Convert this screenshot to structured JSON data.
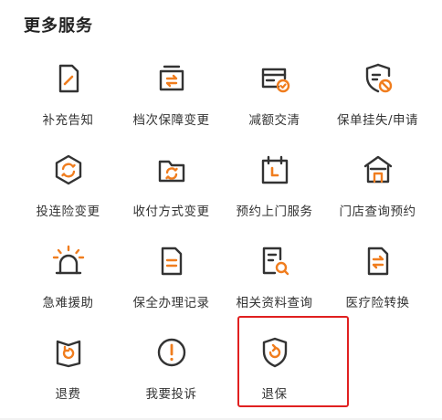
{
  "section": {
    "title": "更多服务"
  },
  "services": [
    {
      "label": "补充告知",
      "icon": "edit-document-icon"
    },
    {
      "label": "档次保障变更",
      "icon": "change-level-icon"
    },
    {
      "label": "减额交清",
      "icon": "card-check-icon"
    },
    {
      "label": "保单挂失/申请",
      "icon": "shield-block-icon"
    },
    {
      "label": "投连险变更",
      "icon": "hexagon-refresh-icon"
    },
    {
      "label": "收付方式变更",
      "icon": "folder-refresh-icon"
    },
    {
      "label": "预约上门服务",
      "icon": "calendar-icon"
    },
    {
      "label": "门店查询预约",
      "icon": "store-icon"
    },
    {
      "label": "急难援助",
      "icon": "alarm-icon"
    },
    {
      "label": "保全办理记录",
      "icon": "record-document-icon"
    },
    {
      "label": "相关资料查询",
      "icon": "document-search-icon"
    },
    {
      "label": "医疗险转换",
      "icon": "document-transfer-icon"
    },
    {
      "label": "退费",
      "icon": "refund-icon"
    },
    {
      "label": "我要投诉",
      "icon": "exclamation-circle-icon"
    },
    {
      "label": "退保",
      "icon": "shield-return-icon"
    }
  ],
  "colors": {
    "accent": "#f07d1e",
    "stroke": "#333333",
    "highlight": "#e02020"
  }
}
